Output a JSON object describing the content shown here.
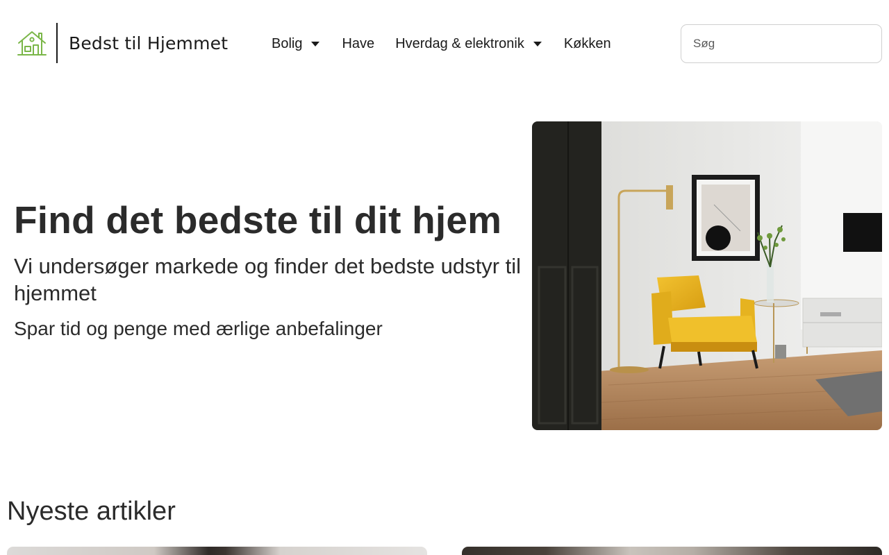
{
  "header": {
    "logo_text": "Bedst til Hjemmet",
    "logo_icon": "house-icon",
    "logo_color": "#7ab648",
    "nav": [
      {
        "label": "Bolig",
        "has_dropdown": true
      },
      {
        "label": "Have",
        "has_dropdown": false
      },
      {
        "label": "Hverdag & elektronik",
        "has_dropdown": true
      },
      {
        "label": "Køkken",
        "has_dropdown": false
      }
    ],
    "search": {
      "placeholder": "Søg",
      "value": ""
    }
  },
  "hero": {
    "title": "Find det bedste til dit hjem",
    "subtitle": "Vi undersøger markede og finder det bedste udstyr til hjemmet",
    "tagline": "Spar tid og penge med ærlige anbefalinger"
  },
  "articles": {
    "title": "Nyeste artikler"
  }
}
